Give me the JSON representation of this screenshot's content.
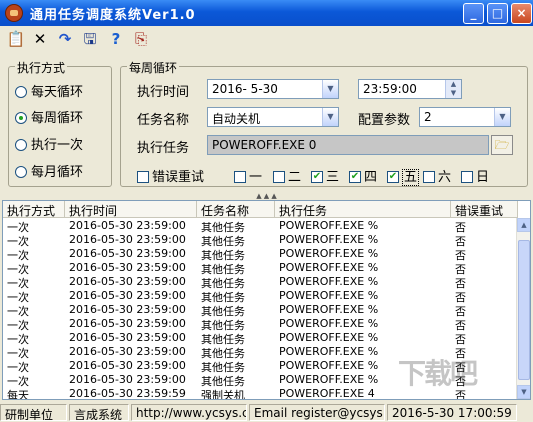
{
  "window": {
    "title": "通用任务调度系统Ver1.0",
    "minimize": "_",
    "restore": "□",
    "close": "×"
  },
  "toolbar": {
    "new": "📋",
    "delete": "✕",
    "refresh": "↷",
    "save": "🖫",
    "help": "?",
    "exit": "⎘"
  },
  "exec_mode": {
    "legend": "执行方式",
    "options": [
      {
        "label": "每天循环",
        "selected": false
      },
      {
        "label": "每周循环",
        "selected": true
      },
      {
        "label": "执行一次",
        "selected": false
      },
      {
        "label": "每月循环",
        "selected": false
      }
    ]
  },
  "weekly": {
    "legend": "每周循环",
    "exec_time_label": "执行时间",
    "date_value": "2016-  5-30",
    "time_value": "23:59:00",
    "task_name_label": "任务名称",
    "task_name_value": "自动关机",
    "config_label": "配置参数",
    "config_value": "2",
    "exec_task_label": "执行任务",
    "exec_task_value": "POWEROFF.EXE 0",
    "retry_label": "错误重试",
    "days": [
      {
        "label": "一",
        "checked": false
      },
      {
        "label": "二",
        "checked": false
      },
      {
        "label": "三",
        "checked": true
      },
      {
        "label": "四",
        "checked": true
      },
      {
        "label": "五",
        "checked": true
      },
      {
        "label": "六",
        "checked": false
      },
      {
        "label": "日",
        "checked": false
      }
    ]
  },
  "table": {
    "headers": [
      "执行方式",
      "执行时间",
      "任务名称",
      "执行任务",
      "错误重试"
    ],
    "rows": [
      [
        "一次",
        "2016-05-30 23:59:00",
        "其他任务",
        "POWEROFF.EXE %",
        "否"
      ],
      [
        "一次",
        "2016-05-30 23:59:00",
        "其他任务",
        "POWEROFF.EXE %",
        "否"
      ],
      [
        "一次",
        "2016-05-30 23:59:00",
        "其他任务",
        "POWEROFF.EXE %",
        "否"
      ],
      [
        "一次",
        "2016-05-30 23:59:00",
        "其他任务",
        "POWEROFF.EXE %",
        "否"
      ],
      [
        "一次",
        "2016-05-30 23:59:00",
        "其他任务",
        "POWEROFF.EXE %",
        "否"
      ],
      [
        "一次",
        "2016-05-30 23:59:00",
        "其他任务",
        "POWEROFF.EXE %",
        "否"
      ],
      [
        "一次",
        "2016-05-30 23:59:00",
        "其他任务",
        "POWEROFF.EXE %",
        "否"
      ],
      [
        "一次",
        "2016-05-30 23:59:00",
        "其他任务",
        "POWEROFF.EXE %",
        "否"
      ],
      [
        "一次",
        "2016-05-30 23:59:00",
        "其他任务",
        "POWEROFF.EXE %",
        "否"
      ],
      [
        "一次",
        "2016-05-30 23:59:00",
        "其他任务",
        "POWEROFF.EXE %",
        "否"
      ],
      [
        "一次",
        "2016-05-30 23:59:00",
        "其他任务",
        "POWEROFF.EXE %",
        "否"
      ],
      [
        "一次",
        "2016-05-30 23:59:00",
        "其他任务",
        "POWEROFF.EXE %",
        "否"
      ],
      [
        "每天",
        "2016-05-30 23:59:59",
        "强制关机",
        "POWEROFF.EXE 4",
        "否"
      ]
    ]
  },
  "status": {
    "unit_label": "研制单位",
    "company": "言成系统",
    "url": "http://www.ycsys.com",
    "email": "Email register@ycsys.com",
    "datetime": "2016-5-30 17:00:59"
  },
  "watermark": "下载吧"
}
